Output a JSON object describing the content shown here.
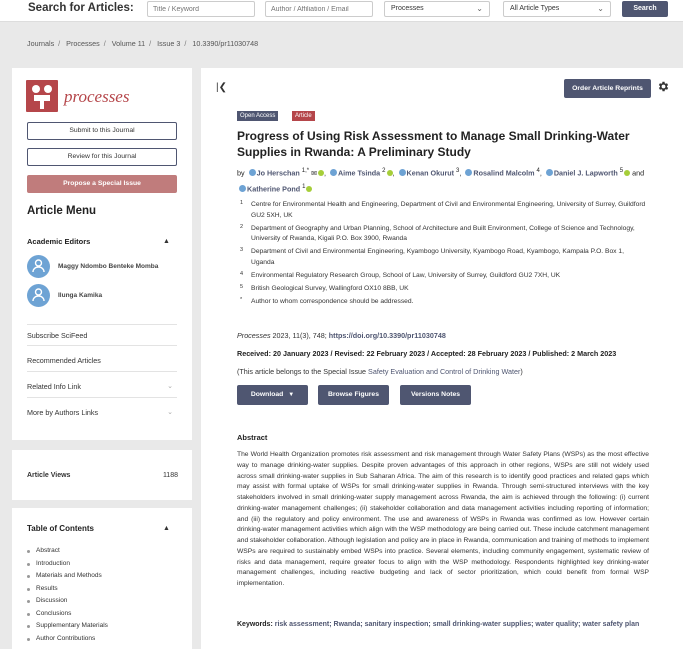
{
  "search": {
    "label": "Search for Articles:",
    "title_placeholder": "Title / Keyword",
    "author_placeholder": "Author / Affiliation / Email",
    "journal_value": "Processes",
    "type_value": "All Article Types",
    "button": "Search"
  },
  "breadcrumb": [
    "Journals",
    "Processes",
    "Volume 11",
    "Issue 3",
    "10.3390/pr11030748"
  ],
  "sidebar": {
    "journal_name": "processes",
    "submit": "Submit to this Journal",
    "review": "Review for this Journal",
    "propose": "Propose a Special Issue",
    "menu_title": "Article Menu",
    "editors_title": "Academic Editors",
    "editors": [
      "Maggy Ndombo Benteke Momba",
      "Ilunga Kamika"
    ],
    "links": [
      {
        "label": "Subscribe SciFeed",
        "chevron": false
      },
      {
        "label": "Recommended Articles",
        "chevron": false
      },
      {
        "label": "Related Info Link",
        "chevron": true
      },
      {
        "label": "More by Authors Links",
        "chevron": true
      }
    ],
    "views_label": "Article Views",
    "views_count": "1188",
    "toc_title": "Table of Contents",
    "toc": [
      "Abstract",
      "Introduction",
      "Materials and Methods",
      "Results",
      "Discussion",
      "Conclusions",
      "Supplementary Materials",
      "Author Contributions"
    ]
  },
  "main": {
    "reprints": "Order Article Reprints",
    "badge_oa": "Open Access",
    "badge_article": "Article",
    "title": "Progress of Using Risk Assessment to Manage Small Drinking-Water Supplies in Rwanda: A Preliminary Study",
    "by": "by",
    "authors": [
      {
        "name": "Jo Herschan",
        "sup": "1,*"
      },
      {
        "name": "Aime Tsinda",
        "sup": "2"
      },
      {
        "name": "Kenan Okurut",
        "sup": "3"
      },
      {
        "name": "Rosalind Malcolm",
        "sup": "4"
      },
      {
        "name": "Daniel J. Lapworth",
        "sup": "5"
      },
      {
        "name": "Katherine Pond",
        "sup": "1"
      }
    ],
    "and_word": "and",
    "affiliations": [
      {
        "n": "1",
        "text": "Centre for Environmental Health and Engineering, Department of Civil and Environmental Engineering, University of Surrey, Guildford GU2 5XH, UK"
      },
      {
        "n": "2",
        "text": "Department of Geography and Urban Planning, School of Architecture and Built Environment, College of Science and Technology, University of Rwanda, Kigali P.O. Box 3900, Rwanda"
      },
      {
        "n": "3",
        "text": "Department of Civil and Environmental Engineering, Kyambogo University, Kyambogo Road, Kyambogo, Kampala P.O. Box 1, Uganda"
      },
      {
        "n": "4",
        "text": "Environmental Regulatory Research Group, School of Law, University of Surrey, Guildford GU2 7XH, UK"
      },
      {
        "n": "5",
        "text": "British Geological Survey, Wallingford OX10 8BB, UK"
      },
      {
        "n": "*",
        "text": "Author to whom correspondence should be addressed."
      }
    ],
    "citation_journal": "Processes",
    "citation_rest": " 2023, 11(3), 748; ",
    "doi": "https://doi.org/10.3390/pr11030748",
    "dates": "Received: 20 January 2023 / Revised: 22 February 2023 / Accepted: 28 February 2023 / Published: 2 March 2023",
    "special_prefix": "(This article belongs to the Special Issue ",
    "special_link": "Safety Evaluation and Control of Drinking Water",
    "special_suffix": ")",
    "btn_download": "Download",
    "btn_figures": "Browse Figures",
    "btn_versions": "Versions Notes",
    "abstract_title": "Abstract",
    "abstract": "The World Health Organization promotes risk assessment and risk management through Water Safety Plans (WSPs) as the most effective way to manage drinking-water supplies. Despite proven advantages of this approach in other regions, WSPs are still not widely used across small drinking-water supplies in Sub Saharan Africa. The aim of this research is to identify good practices and related gaps which may assist with formal uptake of WSPs for small drinking-water supplies in Rwanda. Through semi-structured interviews with the key stakeholders involved in small drinking-water supply management across Rwanda, the aim is achieved through the following: (i) current drinking-water management challenges; (ii) stakeholder collaboration and data management activities including reporting of information; and (iii) the regulatory and policy environment. The use and awareness of WSPs in Rwanda was confirmed as low. However certain drinking-water management activities which align with the WSP methodology are being carried out. These include catchment management and stakeholder collaboration. Although legislation and policy are in place in Rwanda, communication and training of methods to implement WSPs are required to sustainably embed WSPs into practice. Several elements, including community engagement, systematic review of risks and data management, require greater focus to align with the WSP methodology. Respondents highlighted key drinking-water management challenges, including reactive budgeting and lack of sector prioritization, which could benefit from formal WSP implementation.",
    "keywords_label": "Keywords:",
    "keywords": "risk assessment; Rwanda; sanitary inspection; small drinking-water supplies; water quality; water safety plan"
  }
}
